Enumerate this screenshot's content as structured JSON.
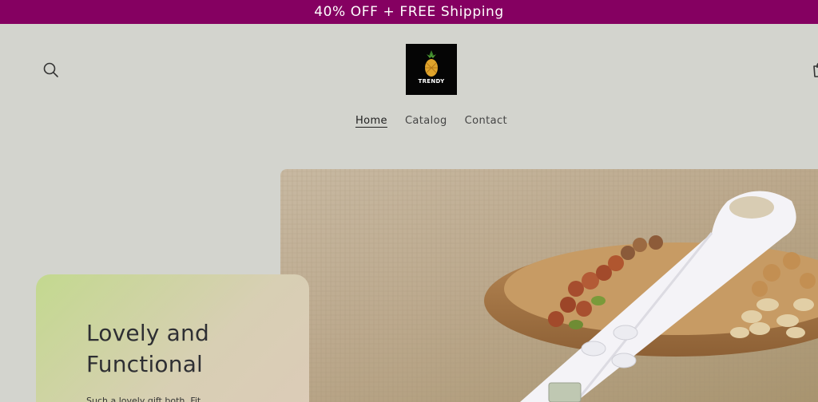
{
  "announcement": {
    "text": "40% OFF + FREE Shipping"
  },
  "header": {
    "logo_text": "TRENDY",
    "search_icon": "search-icon",
    "cart_icon": "cart-icon"
  },
  "nav": {
    "items": [
      {
        "label": "Home",
        "active": true
      },
      {
        "label": "Catalog",
        "active": false
      },
      {
        "label": "Contact",
        "active": false
      }
    ]
  },
  "hero": {
    "card": {
      "title_line1": "Lovely and",
      "title_line2": "Functional",
      "subtitle": "Such a lovely gift both. Fit"
    }
  },
  "colors": {
    "announcement_bg": "#850061",
    "page_bg": "#d3d4ce",
    "card_gradient_start": "#c3d98f",
    "card_gradient_end": "#dccbb8"
  }
}
